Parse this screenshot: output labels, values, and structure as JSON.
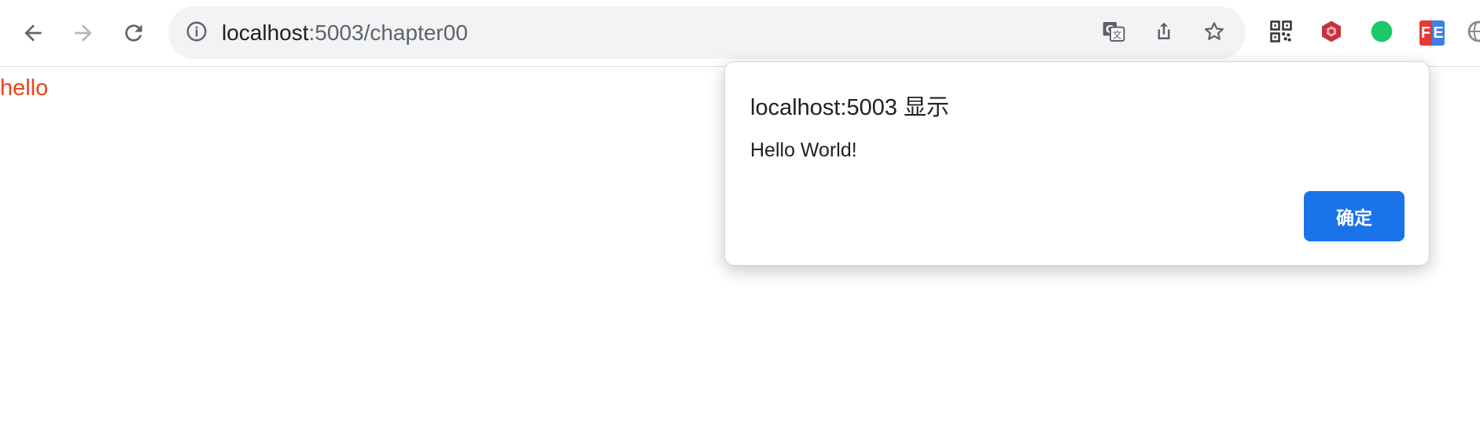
{
  "browser": {
    "address_bar": {
      "host": "localhost",
      "path": ":5003/chapter00"
    },
    "icons": {
      "back": "back-arrow-icon",
      "forward": "forward-arrow-icon",
      "reload": "reload-icon",
      "site_info": "info-icon",
      "translate": "translate-icon",
      "share": "share-icon",
      "bookmark": "star-icon",
      "extensions": [
        "qr-code-extension-icon",
        "hexagon-extension-icon",
        "green-dot-extension-icon",
        "fe-extension-icon",
        "globe-extension-icon"
      ]
    },
    "extension_fe_label": "FE"
  },
  "page": {
    "text": "hello",
    "text_color": "#e8441a"
  },
  "alert_dialog": {
    "title": "localhost:5003 显示",
    "message": "Hello World!",
    "ok_label": "确定",
    "ok_color": "#1a73e8"
  }
}
